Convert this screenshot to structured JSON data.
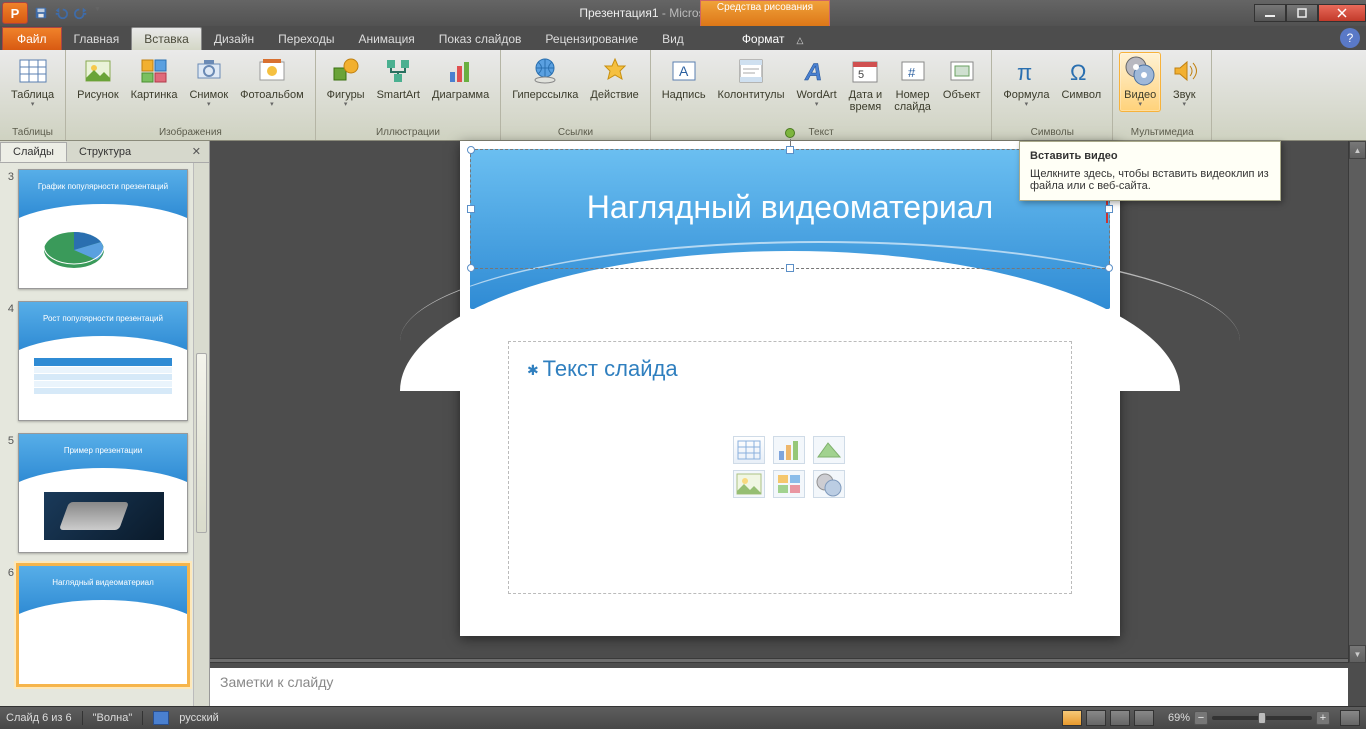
{
  "title": {
    "doc": "Презентация1",
    "app": "Microsoft PowerPoint"
  },
  "context_tab": "Средства рисования",
  "context_sub": "Формат",
  "tabs": {
    "file": "Файл",
    "items": [
      "Главная",
      "Вставка",
      "Дизайн",
      "Переходы",
      "Анимация",
      "Показ слайдов",
      "Рецензирование",
      "Вид"
    ],
    "active": 1
  },
  "ribbon": {
    "tables": {
      "label": "Таблицы",
      "btns": [
        {
          "l": "Таблица",
          "dd": true
        }
      ]
    },
    "images": {
      "label": "Изображения",
      "btns": [
        {
          "l": "Рисунок"
        },
        {
          "l": "Картинка"
        },
        {
          "l": "Снимок",
          "dd": true
        },
        {
          "l": "Фотоальбом",
          "dd": true
        }
      ]
    },
    "illust": {
      "label": "Иллюстрации",
      "btns": [
        {
          "l": "Фигуры",
          "dd": true
        },
        {
          "l": "SmartArt"
        },
        {
          "l": "Диаграмма"
        }
      ]
    },
    "links": {
      "label": "Ссылки",
      "btns": [
        {
          "l": "Гиперссылка"
        },
        {
          "l": "Действие"
        }
      ]
    },
    "text": {
      "label": "Текст",
      "btns": [
        {
          "l": "Надпись"
        },
        {
          "l": "Колонтитулы"
        },
        {
          "l": "WordArt",
          "dd": true
        },
        {
          "l": "Дата и\nвремя"
        },
        {
          "l": "Номер\nслайда"
        },
        {
          "l": "Объект"
        }
      ]
    },
    "symbols": {
      "label": "Символы",
      "btns": [
        {
          "l": "Формула",
          "dd": true
        },
        {
          "l": "Символ"
        }
      ]
    },
    "media": {
      "label": "Мультимедиа",
      "btns": [
        {
          "l": "Видео",
          "dd": true,
          "hi": true
        },
        {
          "l": "Звук",
          "dd": true
        }
      ]
    }
  },
  "sidepanel": {
    "tabs": [
      "Слайды",
      "Структура"
    ],
    "slides": [
      {
        "n": "3",
        "t": "График популярности презентаций"
      },
      {
        "n": "4",
        "t": "Рост популярности презентаций"
      },
      {
        "n": "5",
        "t": "Пример презентации"
      },
      {
        "n": "6",
        "t": "Наглядный видеоматериал",
        "sel": true
      }
    ]
  },
  "slide": {
    "title": "Наглядный видеоматериал",
    "body_ph": "Текст слайда"
  },
  "notes_ph": "Заметки к слайду",
  "tooltip": {
    "title": "Вставить видео",
    "body": "Щелкните здесь, чтобы вставить видеоклип из файла или с веб-сайта."
  },
  "status": {
    "slide_info": "Слайд 6 из 6",
    "theme": "\"Волна\"",
    "lang": "русский",
    "zoom": "69%"
  }
}
